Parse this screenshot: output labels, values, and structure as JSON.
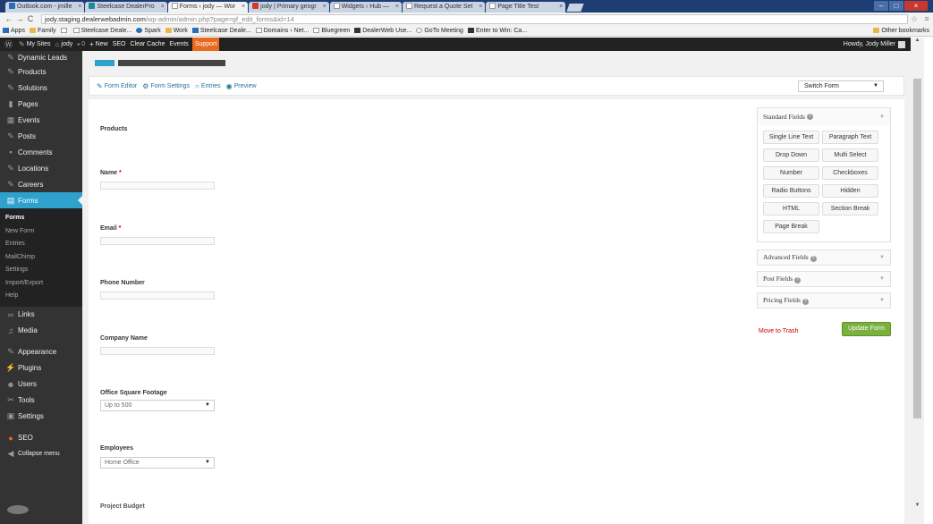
{
  "browser": {
    "tabs": [
      {
        "label": "Outlook.com - jmille"
      },
      {
        "label": "Steelcase DealerPro"
      },
      {
        "label": "Forms ‹ jody — Wor"
      },
      {
        "label": "jody | Primary geogr"
      },
      {
        "label": "Widgets ‹ Hub —"
      },
      {
        "label": "Request a Quote Set"
      },
      {
        "label": "Page Title Test"
      }
    ],
    "url_host": "jody.staging.dealerwebadmin.com",
    "url_path": "/wp-admin/admin.php?page=gf_edit_forms&id=14",
    "bookmarks": [
      "Apps",
      "Family",
      "Steelcase Deale...",
      "Spark",
      "Work",
      "Steelcase Deale...",
      "Domains ‹ Net...",
      "Bluegreen",
      "DealerWeb Use...",
      "GoTo Meeting",
      "Enter to Win: Ca..."
    ],
    "other_bookmarks": "Other bookmarks"
  },
  "adminbar": {
    "my_sites": "My Sites",
    "site": "jody",
    "comments_count": "0",
    "new": "New",
    "seo": "SEO",
    "clear_cache": "Clear Cache",
    "events": "Events",
    "support": "Support",
    "howdy": "Howdy, Jody Miller"
  },
  "sidebar": {
    "items_top": [
      "Dynamic Leads",
      "Products",
      "Solutions",
      "Pages",
      "Events",
      "Posts",
      "Comments",
      "Locations",
      "Careers"
    ],
    "forms": "Forms",
    "forms_sub": [
      "Forms",
      "New Form",
      "Entries",
      "MailChimp",
      "Settings",
      "Import/Export",
      "Help"
    ],
    "items_bottom": [
      "Links",
      "Media",
      "Appearance",
      "Plugins",
      "Users",
      "Tools",
      "Settings",
      "SEO",
      "Collapse menu"
    ]
  },
  "toolbar": {
    "form_editor": "Form Editor",
    "form_settings": "Form Settings",
    "entries": "Entries",
    "preview": "Preview",
    "switch_form": "Switch Form"
  },
  "form_fields": {
    "products": "Products",
    "name": "Name",
    "email": "Email",
    "required_mark": "*",
    "phone": "Phone Number",
    "company": "Company Name",
    "footage": "Office Square Footage",
    "footage_value": "Up to 500",
    "employees": "Employees",
    "employees_value": "Home Office",
    "budget": "Project Budget"
  },
  "fields_panel": {
    "standard": "Standard Fields",
    "buttons": [
      "Single Line Text",
      "Paragraph Text",
      "Drop Down",
      "Multi Select",
      "Number",
      "Checkboxes",
      "Radio Buttons",
      "Hidden",
      "HTML",
      "Section Break",
      "Page Break"
    ],
    "advanced": "Advanced Fields",
    "post": "Post Fields",
    "pricing": "Pricing Fields",
    "help_icon": "?"
  },
  "actions": {
    "trash": "Move to Trash",
    "update": "Update Form"
  }
}
